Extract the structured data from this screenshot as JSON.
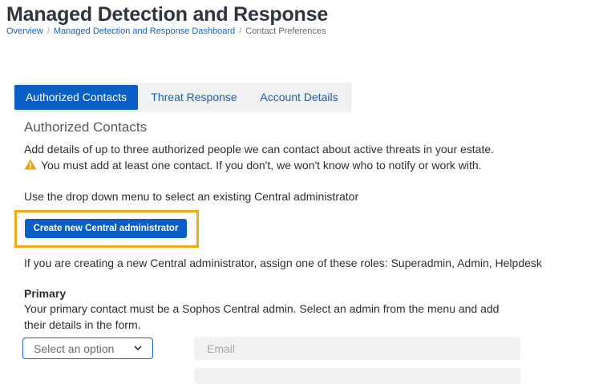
{
  "header": {
    "title": "Managed Detection and Response",
    "breadcrumb": {
      "overview": "Overview",
      "dashboard": "Managed Detection and Response Dashboard",
      "current": "Contact Preferences",
      "separator": "/"
    }
  },
  "tabs": [
    {
      "label": "Authorized Contacts",
      "active": true
    },
    {
      "label": "Threat Response",
      "active": false
    },
    {
      "label": "Account Details",
      "active": false
    }
  ],
  "section": {
    "heading": "Authorized Contacts",
    "intro": "Add details of up to three authorized people we can contact about active threats in your estate.",
    "warning": "You must add at least one contact. If you don't, we won't know who to notify or work with.",
    "warning_icon": "warning-icon",
    "dropdown_hint": "Use the drop down menu to select an existing Central administrator",
    "create_button": "Create new Central administrator",
    "roles_hint": "If you are creating a new Central administrator, assign one of these roles: Superadmin, Admin, Helpdesk"
  },
  "primary": {
    "label": "Primary",
    "description_line1": "Your primary contact must be a Sophos Central admin. Select an admin from the menu and add",
    "description_line2": "their details in the form.",
    "select_placeholder": "Select an option",
    "email_placeholder": "Email"
  },
  "colors": {
    "accent": "#0b5ec6",
    "highlight": "#f0a911",
    "warning": "#e8a317",
    "link": "#1b5fb8"
  }
}
